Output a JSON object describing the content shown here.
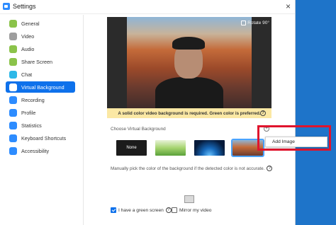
{
  "window": {
    "title": "Settings",
    "close_glyph": "×"
  },
  "sidebar": {
    "items": [
      {
        "label": "General",
        "icon": "gear-icon",
        "color": "#8bc34a"
      },
      {
        "label": "Video",
        "icon": "video-icon",
        "color": "#9e9e9e"
      },
      {
        "label": "Audio",
        "icon": "headphones-icon",
        "color": "#8bc34a"
      },
      {
        "label": "Share Screen",
        "icon": "share-screen-icon",
        "color": "#8bc34a"
      },
      {
        "label": "Chat",
        "icon": "chat-icon",
        "color": "#2db8e8"
      },
      {
        "label": "Virtual Background",
        "icon": "person-icon",
        "color": "#ffffff",
        "active": true
      },
      {
        "label": "Recording",
        "icon": "record-icon",
        "color": "#2d8cff"
      },
      {
        "label": "Profile",
        "icon": "profile-icon",
        "color": "#2d8cff"
      },
      {
        "label": "Statistics",
        "icon": "statistics-icon",
        "color": "#2d8cff"
      },
      {
        "label": "Keyboard Shortcuts",
        "icon": "keyboard-icon",
        "color": "#2d8cff"
      },
      {
        "label": "Accessibility",
        "icon": "accessibility-icon",
        "color": "#2d8cff"
      }
    ]
  },
  "preview": {
    "rotate_label": "Rotate 90°",
    "warning_text": "A solid color video background is required. Green color is preferred.",
    "help_glyph": "?"
  },
  "virtual_background": {
    "choose_label": "Choose Virtual Background",
    "add_glyph": "+",
    "thumbnails": [
      {
        "label": "None"
      },
      {
        "label": ""
      },
      {
        "label": ""
      },
      {
        "label": ""
      }
    ]
  },
  "hint_text": "Manually pick the color of the background if the detected color is not accurate.",
  "checkboxes": {
    "green_screen_label": "I have a green screen",
    "green_screen_checked": true,
    "mirror_label": "Mirror my video",
    "mirror_checked": false
  },
  "context_menu": {
    "add_image_label": "Add Image"
  },
  "colors": {
    "accent": "#0e71eb",
    "highlight": "#e0142d",
    "desktop": "#1e74c9"
  }
}
